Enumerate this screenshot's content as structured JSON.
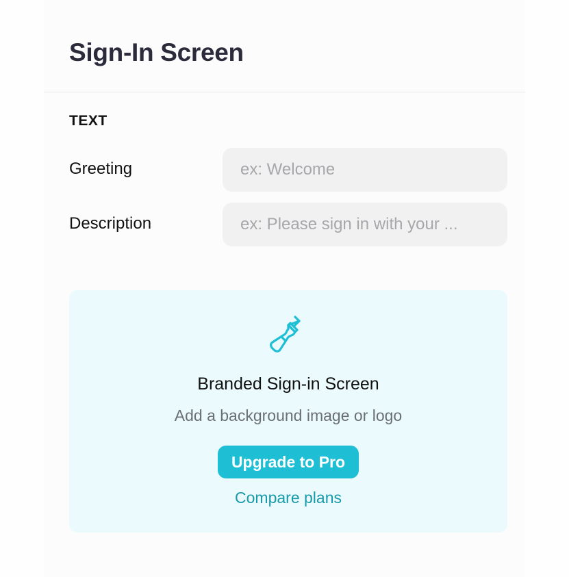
{
  "header": {
    "title": "Sign-In Screen"
  },
  "section": {
    "label": "TEXT"
  },
  "fields": {
    "greeting": {
      "label": "Greeting",
      "placeholder": "ex: Welcome"
    },
    "description": {
      "label": "Description",
      "placeholder": "ex: Please sign in with your ..."
    }
  },
  "promo": {
    "icon": "paintbrush-icon",
    "title": "Branded Sign-in Screen",
    "subtitle": "Add a background image or logo",
    "upgrade_label": "Upgrade to Pro",
    "compare_label": "Compare plans",
    "accent_color": "#1ebfd5",
    "background_color": "#ebfafd"
  }
}
